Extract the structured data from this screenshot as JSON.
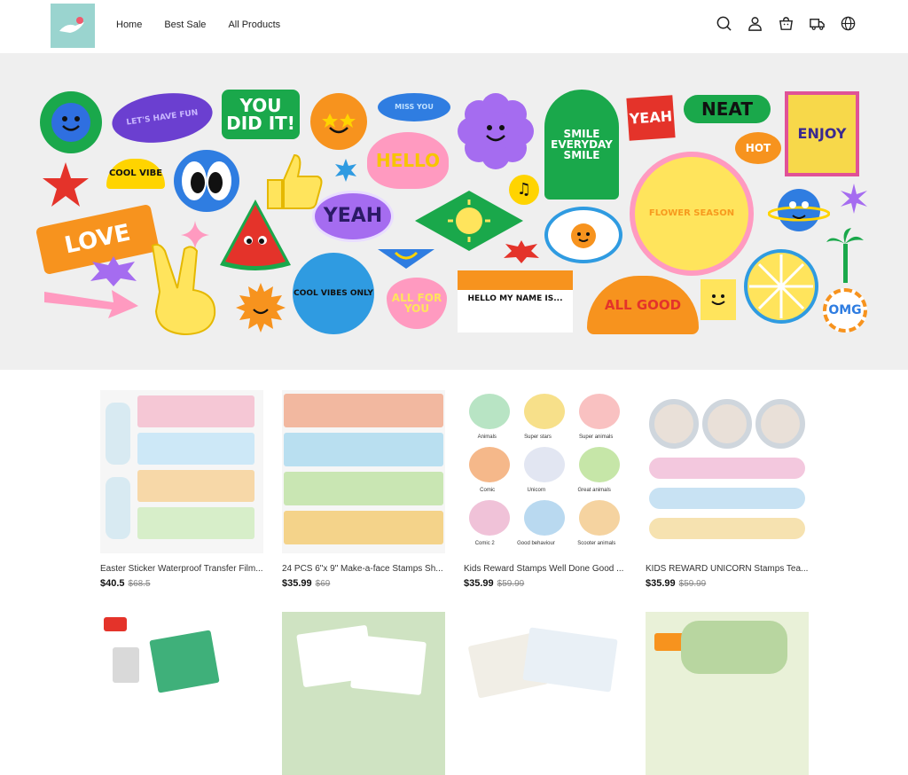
{
  "header": {
    "nav": [
      "Home",
      "Best Sale",
      "All Products"
    ],
    "icons": [
      "search-icon",
      "account-icon",
      "cart-icon",
      "track-order-icon",
      "globe-icon"
    ]
  },
  "hero": {
    "stickers": [
      "YOU DID IT!",
      "NEAT",
      "YEAH",
      "LOVE",
      "HELLO",
      "YEAH",
      "SMILE EVERYDAY SMILE",
      "COOL VIBE",
      "FLOWER SEASON",
      "HELLO MY NAME IS...",
      "ALL GOOD",
      "OMG",
      "COOL VIBES ONLY",
      "ALL FOR YOU",
      "MISS YOU",
      "HOT",
      "ENJOY",
      "LET'S HAVE FUN",
      "SMILE EVERYDAY",
      "LET'S HAVE FUN"
    ]
  },
  "products": [
    {
      "title": "Easter Sticker Waterproof Transfer Film...",
      "price": "$40.5",
      "old_price": "$68.5"
    },
    {
      "title": "24 PCS 6\"x 9\" Make-a-face Stamps Sh...",
      "price": "$35.99",
      "old_price": "$69"
    },
    {
      "title": "Kids Reward Stamps Well Done Good ...",
      "price": "$35.99",
      "old_price": "$59.99"
    },
    {
      "title": "KIDS REWARD UNICORN Stamps Tea...",
      "price": "$35.99",
      "old_price": "$59.99"
    }
  ],
  "product_labels": {
    "kids_reward": [
      "Animals",
      "Super stars",
      "Super animals",
      "Comic",
      "Unicorn",
      "Great animals",
      "Comic 2",
      "Good behaviour",
      "Scooter animals"
    ]
  },
  "colors": {
    "logo_bg": "#9ad4cf",
    "hero_bg": "#efefef",
    "price_text": "#111111",
    "old_price_text": "#888888"
  }
}
